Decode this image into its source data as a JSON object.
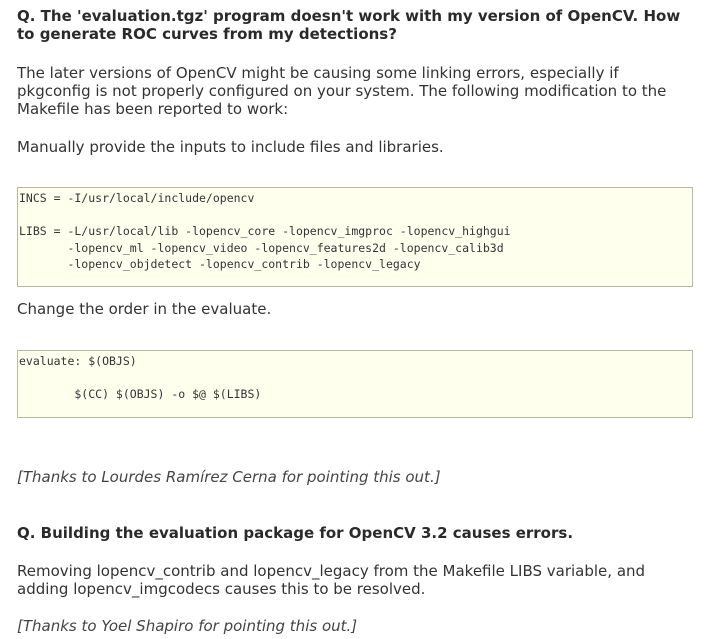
{
  "faq": {
    "q1": {
      "question": "Q. The 'evaluation.tgz' program doesn't work with my version of OpenCV. How to generate ROC curves from my detections?",
      "intro": "The later versions of OpenCV might be causing some linking errors, especially if pkgconfig is not properly configured on your system. The following modification to the Makefile has been reported to work:",
      "step1": "Manually provide the inputs to include files and libraries.",
      "code1": "INCS = -I/usr/local/include/opencv\n\nLIBS = -L/usr/local/lib -lopencv_core -lopencv_imgproc -lopencv_highgui\n       -lopencv_ml -lopencv_video -lopencv_features2d -lopencv_calib3d\n       -lopencv_objdetect -lopencv_contrib -lopencv_legacy",
      "step2": "Change the order in the evaluate.",
      "code2": "evaluate: $(OBJS)\n\n        $(CC) $(OBJS) -o $@ $(LIBS)",
      "thanks": "[Thanks to Lourdes Ramírez Cerna for pointing this out.]"
    },
    "q2": {
      "question": "Q. Building the evaluation package for OpenCV 3.2 causes errors.",
      "answer": "Removing lopencv_contrib and lopencv_legacy from the Makefile LIBS variable, and adding lopencv_imgcodecs causes this to be resolved.",
      "thanks": "[Thanks to Yoel Shapiro for pointing this out.]"
    }
  }
}
